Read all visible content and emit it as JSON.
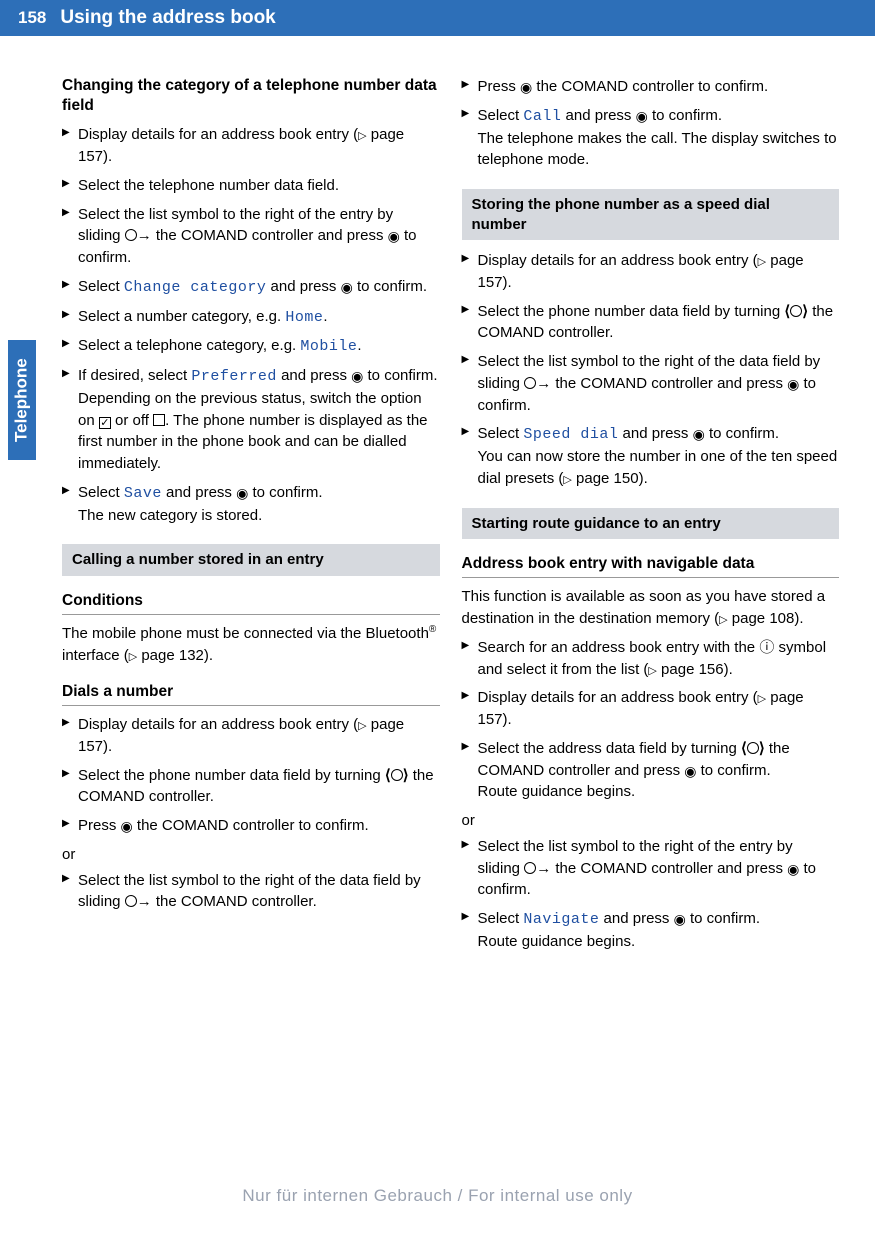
{
  "page_number": "158",
  "chapter_title": "Using the address book",
  "side_tab": "Telephone",
  "left": {
    "h1": "Changing the category of a telephone number data field",
    "items": [
      "Display details for an address book entry (▷ page 157).",
      "Select the telephone number data field.",
      "Select the list symbol to the right of the entry by sliding ◯→ the COMAND controller and press ⊙ to confirm.",
      "Select {Change category} and press ⊙ to confirm.",
      "Select a number category, e.g. {Home}.",
      "Select a telephone category, e.g. {Mobile}.",
      "If desired, select {Preferred} and press ⊙ to confirm.\nDepending on the previous status, switch the option on ☑ or off ☐. The phone number is displayed as the first number in the phone book and can be dialled immediately.",
      "Select {Save} and press ⊙ to confirm.\nThe new category is stored."
    ],
    "gray1": "Calling a number stored in an entry",
    "h2": "Conditions",
    "p1": "The mobile phone must be connected via the Bluetooth® interface (▷ page 132).",
    "h3": "Dials a number",
    "dial": [
      "Display details for an address book entry (▷ page 157).",
      "Select the phone number data field by turning ⟲◯⟳ the COMAND controller.",
      "Press ⊙ the COMAND controller to confirm."
    ],
    "or": "or",
    "dial2": [
      "Select the list symbol to the right of the data field by sliding ◯→ the COMAND controller."
    ]
  },
  "right": {
    "top": [
      "Press ⊙ the COMAND controller to confirm.",
      "Select {Call} and press ⊙ to confirm.\nThe telephone makes the call. The display switches to telephone mode."
    ],
    "gray1": "Storing the phone number as a speed dial number",
    "store": [
      "Display details for an address book entry (▷ page 157).",
      "Select the phone number data field by turning ⟲◯⟳ the COMAND controller.",
      "Select the list symbol to the right of the data field by sliding ◯→ the COMAND controller and press ⊙ to confirm.",
      "Select {Speed dial} and press ⊙ to confirm.\nYou can now store the number in one of the ten speed dial presets (▷ page 150)."
    ],
    "gray2": "Starting route guidance to an entry",
    "h1": "Address book entry with navigable data",
    "p1": "This function is available as soon as you have stored a destination in the destination memory (▷ page 108).",
    "nav": [
      "Search for an address book entry with the ⓘ symbol and select it from the list (▷ page 156).",
      "Display details for an address book entry (▷ page 157).",
      "Select the address data field by turning ⟲◯⟳ the COMAND controller and press ⊙ to confirm.\nRoute guidance begins."
    ],
    "or": "or",
    "nav2": [
      "Select the list symbol to the right of the entry by sliding ◯→ the COMAND controller and press ⊙ to confirm.",
      "Select {Navigate} and press ⊙ to confirm.\nRoute guidance begins."
    ]
  },
  "footer": "Nur für internen Gebrauch / For internal use only",
  "mono_terms": {
    "change_category": "Change category",
    "home": "Home",
    "mobile": "Mobile",
    "preferred": "Preferred",
    "save": "Save",
    "call": "Call",
    "speed_dial": "Speed dial",
    "navigate": "Navigate"
  }
}
